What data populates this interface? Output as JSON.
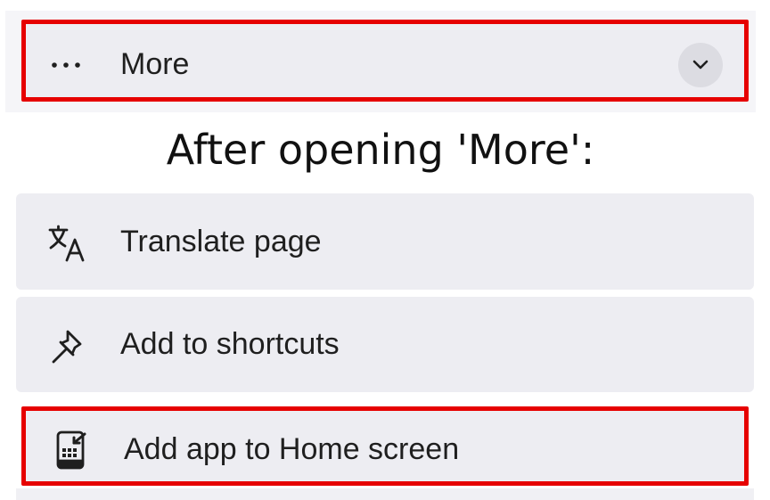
{
  "more_row": {
    "label": "More",
    "icon": "more-horizontal-icon",
    "expand_icon": "chevron-down-icon"
  },
  "caption": "After opening 'More':",
  "menu": {
    "items": [
      {
        "label": "Translate page",
        "icon": "translate-icon"
      },
      {
        "label": "Add to shortcuts",
        "icon": "pin-icon"
      },
      {
        "label": "Add app to Home screen",
        "icon": "add-to-home-screen-icon"
      }
    ]
  },
  "colors": {
    "highlight": "#e60000",
    "row_background": "#ededf2",
    "chevron_background": "#dcdce2"
  }
}
